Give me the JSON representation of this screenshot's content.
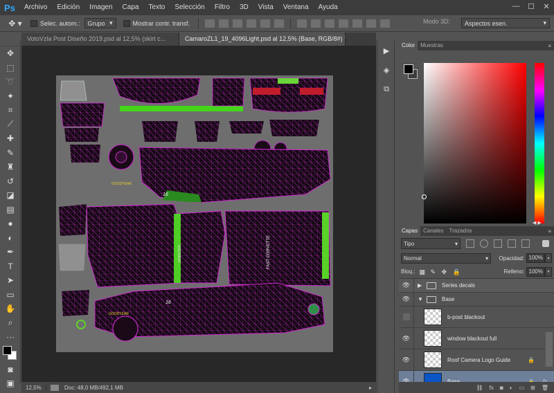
{
  "app": {
    "logo": "Ps"
  },
  "menu": [
    "Archivo",
    "Edición",
    "Imagen",
    "Capa",
    "Texto",
    "Selección",
    "Filtro",
    "3D",
    "Vista",
    "Ventana",
    "Ayuda"
  ],
  "window": {
    "minimize": "—",
    "maximize": "☐",
    "close": "✕"
  },
  "options": {
    "auto_select_label": "Selec. autom.:",
    "auto_select_value": "Grupo",
    "show_transform_label": "Mostrar contr. transf.",
    "mode3d_label": "Modo 3D:",
    "workspace": "Aspectos esen."
  },
  "doc_tabs": [
    {
      "label": "VotoVzla Post Diseño 2019.psd al 12,5% (skirt c...",
      "close": "×"
    },
    {
      "label": "CamaroZL1_19_4096Light.psd al 12,5% (Base, RGB/8#) *",
      "close": "×"
    }
  ],
  "status": {
    "zoom": "12,5%",
    "doc": "Doc: 48,0 MB/492,1 MB"
  },
  "color_panel": {
    "tabs": [
      "Color",
      "Muestras"
    ],
    "fg": "#000000",
    "bg": "#3c3c3c"
  },
  "layers_panel": {
    "tabs": [
      "Capas",
      "Canales",
      "Trazados"
    ],
    "kind": "Tipo",
    "blend": "Normal",
    "opacity_label": "Opacidad:",
    "opacity": "100%",
    "lock_label": "Bloq.:",
    "fill_label": "Relleno:",
    "fill": "100%",
    "layers": [
      {
        "name": "Series decals",
        "type": "group",
        "expanded": false,
        "visible": true
      },
      {
        "name": "Base",
        "type": "group",
        "expanded": true,
        "visible": true
      },
      {
        "name": "b-post blackout",
        "type": "layer",
        "visible": false
      },
      {
        "name": "window blackout full",
        "type": "layer",
        "visible": true
      },
      {
        "name": "Roof Camera Logo Guide",
        "type": "layer",
        "visible": true,
        "locked": true
      },
      {
        "name": "Base",
        "type": "layer",
        "visible": true,
        "locked": true,
        "fx": true,
        "selected": true
      }
    ]
  },
  "texture": {
    "labels": [
      "GOODYEAR",
      "16",
      "MONSTER",
      "FAST CORVETTE",
      "16",
      "GOODYEAR"
    ]
  }
}
